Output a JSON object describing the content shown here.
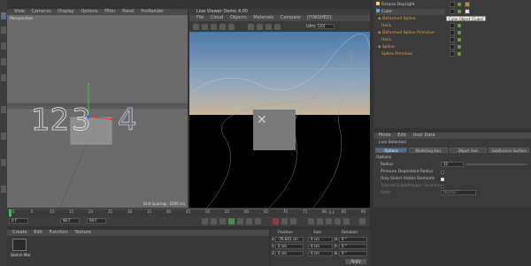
{
  "left_viewport": {
    "menus": [
      "View",
      "Cameras",
      "Display",
      "Options",
      "Filter",
      "Panel",
      "ProRender"
    ],
    "label": "Perspective",
    "grid_spacing": "Grid Spacing : 1000 cm"
  },
  "live_viewer": {
    "title": "Live Viewer Demo 4.00",
    "menus": [
      "File",
      "Cloud",
      "Objects",
      "Materials",
      "Compare"
    ],
    "status": "[FINISHED]",
    "ulm_label": "Ulm",
    "ulm_value": "[20]"
  },
  "object_manager": {
    "items": [
      {
        "name": "Octane DayLight",
        "indent": 0,
        "color": "normal"
      },
      {
        "name": "Cube",
        "indent": 0,
        "color": "normal"
      },
      {
        "name": "Deformed Spline",
        "indent": 1,
        "color": "orange"
      },
      {
        "name": "Helix",
        "indent": 2,
        "color": "orange"
      },
      {
        "name": "Deformed Spline Primitive",
        "indent": 1,
        "color": "orange"
      },
      {
        "name": "Helix",
        "indent": 2,
        "color": "orange"
      },
      {
        "name": "Spline",
        "indent": 1,
        "color": "orange"
      },
      {
        "name": "Spline Primitive",
        "indent": 2,
        "color": "orange"
      }
    ],
    "tooltip": "Cube Object [Cube]"
  },
  "attributes": {
    "menus": [
      "Mode",
      "Edit",
      "User Data"
    ],
    "title": "Live Selection",
    "tabs": [
      "Options",
      "Modelling Axis",
      "Object Axis",
      "Subdivision Surface"
    ],
    "section": "Options",
    "radius_label": "Radius",
    "radius_value": "32",
    "pressure_label": "Pressure Dependent Radius",
    "only_visible_label": "Only Select Visible Elements",
    "tolerant_label": "Tolerant Edge/Polygon Selection",
    "mode_label": "Mode",
    "mode_value": "Normal"
  },
  "timeline": {
    "ticks": [
      "0",
      "5",
      "10",
      "15",
      "20",
      "25",
      "30",
      "35",
      "40",
      "45",
      "50",
      "55",
      "60",
      "65",
      "70",
      "75",
      "80",
      "85",
      "90"
    ],
    "current_frame": "0 F",
    "start_frame": "0 F",
    "end_frame": "90 F",
    "end_frame2": "90 F"
  },
  "material_manager": {
    "menus": [
      "Create",
      "Edit",
      "Function",
      "Texture"
    ],
    "material_name": "Sketch Mat"
  },
  "coordinates": {
    "headers": [
      "Position",
      "Size",
      "Rotation"
    ],
    "rows": [
      {
        "axis": "X",
        "pos": "-76.641 cm",
        "size": "0 cm",
        "rot_axis": "H",
        "rot": "0 °"
      },
      {
        "axis": "Y",
        "pos": "0 cm",
        "size": "0 cm",
        "rot_axis": "P",
        "rot": "0 °"
      },
      {
        "axis": "Z",
        "pos": "0 cm",
        "size": "0 cm",
        "rot_axis": "B",
        "rot": "0 °"
      }
    ],
    "apply_label": "Apply"
  }
}
